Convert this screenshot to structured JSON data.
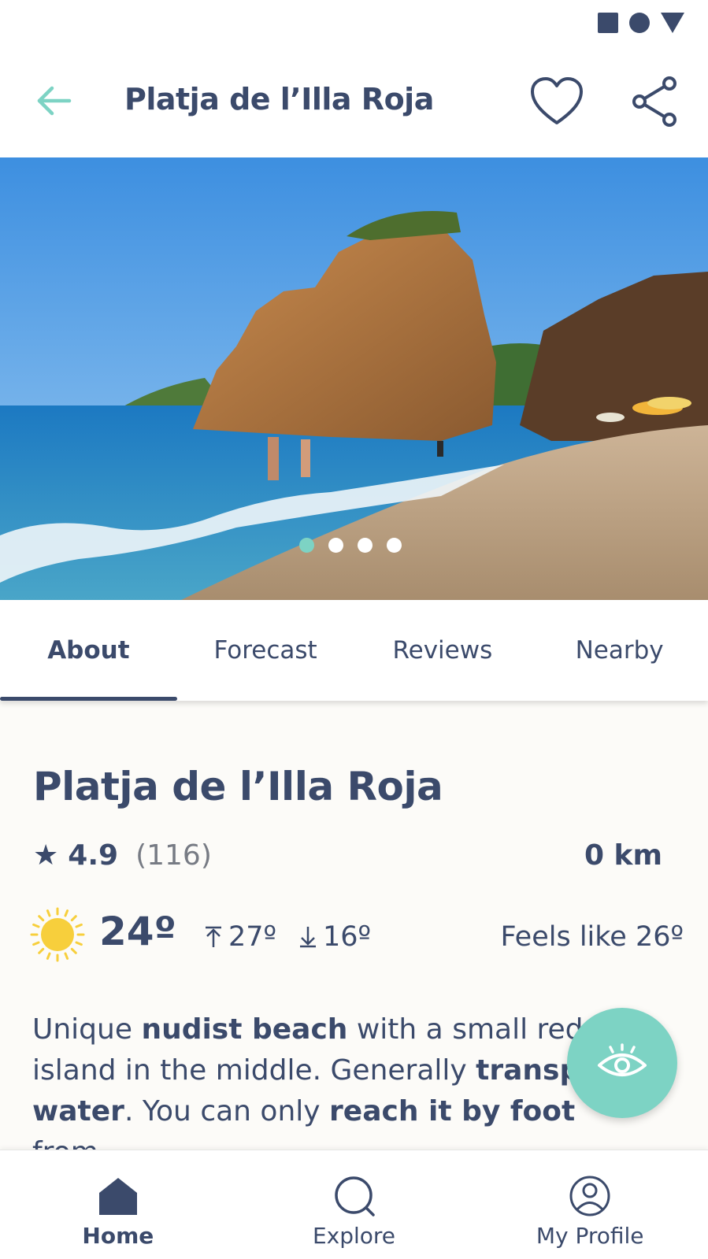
{
  "header": {
    "title": "Platja de l’Illa Roja"
  },
  "icons": {
    "back": "arrow-left-icon",
    "favorite": "heart-icon",
    "share": "share-icon",
    "sun": "sun-icon",
    "eye": "eye-icon",
    "home": "home-icon",
    "explore": "search-icon",
    "profile": "profile-icon"
  },
  "colors": {
    "primary": "#3b4a6b",
    "accent": "#7dd3c4",
    "sun": "#f7cf3c",
    "content_bg": "#fcfbf8"
  },
  "gallery": {
    "slide_count": 4,
    "active_index": 0
  },
  "tabs": [
    {
      "label": "About",
      "active": true
    },
    {
      "label": "Forecast",
      "active": false
    },
    {
      "label": "Reviews",
      "active": false
    },
    {
      "label": "Nearby",
      "active": false
    }
  ],
  "about": {
    "name": "Platja de l’Illa Roja",
    "rating": "4.9",
    "review_count": "(116)",
    "distance": "0 km",
    "weather": {
      "temperature": "24º",
      "max": "27º",
      "min": "16º",
      "feels_like": "Feels like 26º"
    },
    "description": {
      "p1": "Unique ",
      "b1": "nudist beach",
      "p2": " with a small redd",
      "p3": "island in the middle. Generally ",
      "b2": "transpa",
      "b3": "water",
      "p4": ". You can only ",
      "b4": "reach it by foot",
      "p5": " from"
    }
  },
  "bottom_nav": [
    {
      "label": "Home",
      "active": true
    },
    {
      "label": "Explore",
      "active": false
    },
    {
      "label": "My Profile",
      "active": false
    }
  ]
}
